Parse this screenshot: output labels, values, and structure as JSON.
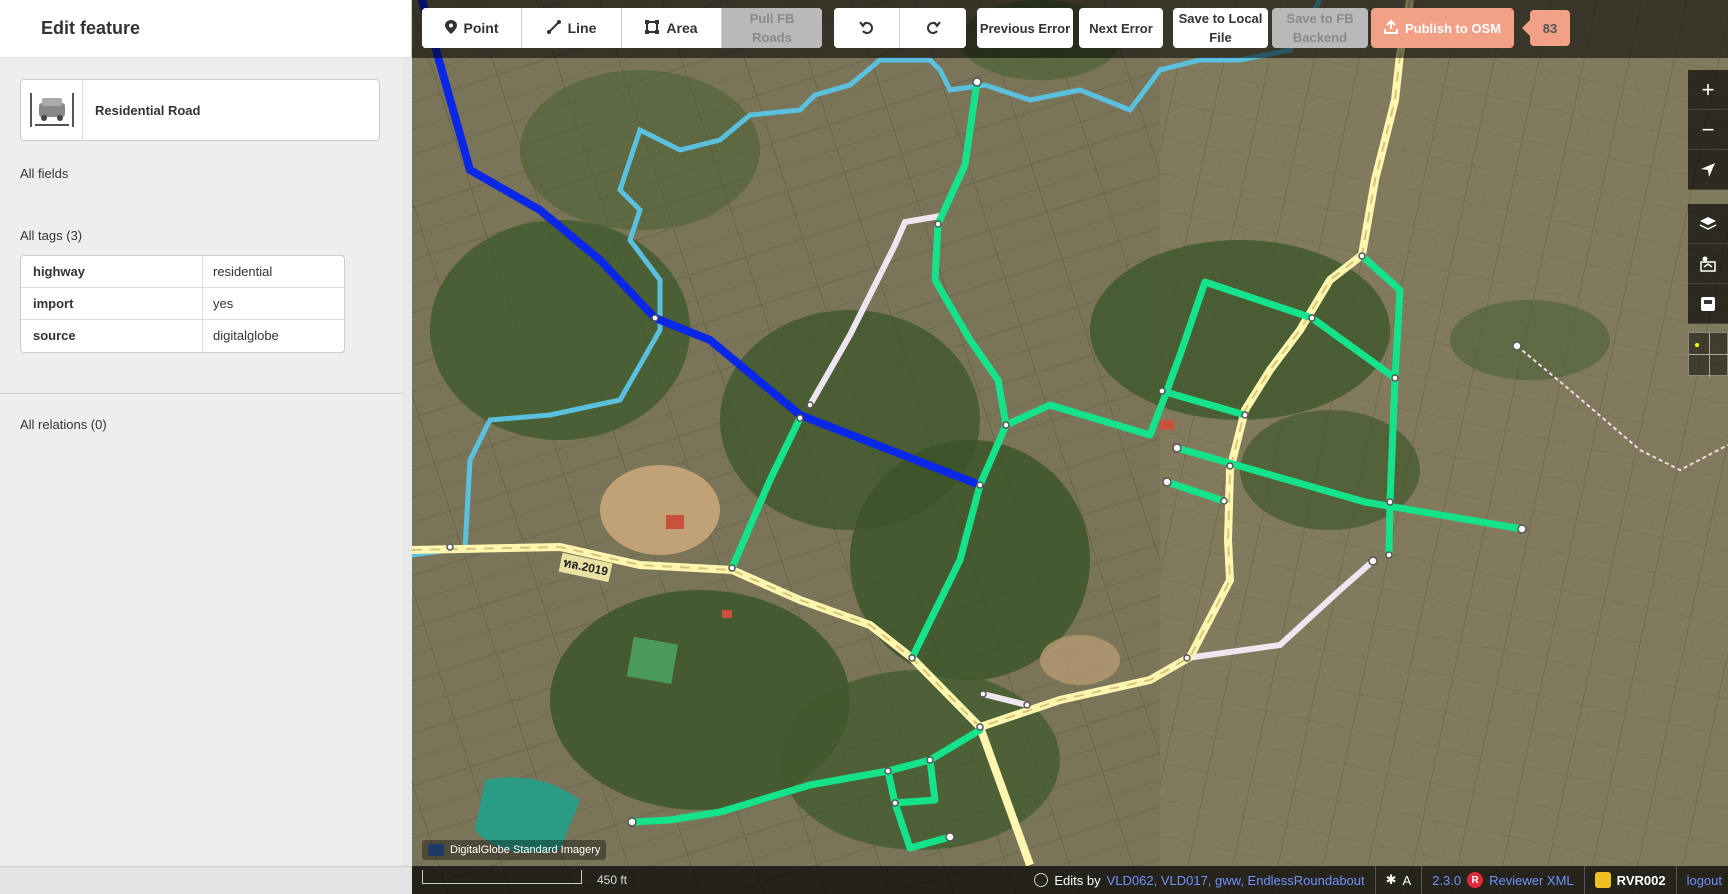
{
  "sidebar": {
    "title": "Edit feature",
    "preset": {
      "name": "Residential Road",
      "icon": "car-road-icon"
    },
    "all_fields_label": "All fields",
    "all_tags_label": "All tags (3)",
    "tags": [
      {
        "key": "highway",
        "value": "residential"
      },
      {
        "key": "import",
        "value": "yes"
      },
      {
        "key": "source",
        "value": "digitalglobe"
      }
    ],
    "all_relations_label": "All relations (0)"
  },
  "toolbar": {
    "point_label": "Point",
    "line_label": "Line",
    "area_label": "Area",
    "pull_fb_roads_line1": "Pull FB",
    "pull_fb_roads_line2": "Roads",
    "undo_icon": "undo-icon",
    "redo_icon": "redo-icon",
    "previous_error_label": "Previous Error",
    "next_error_label": "Next Error",
    "save_local_line1": "Save to Local",
    "save_local_line2": "File",
    "save_fb_line1": "Save to FB",
    "save_fb_line2": "Backend",
    "publish_label": "Publish to OSM",
    "edit_count": "83"
  },
  "map": {
    "road_label": "ทล.2019",
    "imagery_attribution": "DigitalGlobe Standard Imagery",
    "scale_label": "450 ft",
    "colors": {
      "residential": "#15e38b",
      "primary": "#0a26e6",
      "secondary": "#fff6b0",
      "track": "#f0e6f0",
      "waterway": "#5bc0de"
    }
  },
  "map_controls": [
    "zoom-in-icon",
    "zoom-out-icon",
    "locate-icon",
    "layers-icon",
    "map-data-icon",
    "issues-icon"
  ],
  "footer": {
    "edits_by_label": "Edits by",
    "editors": "VLD062, VLD017, gww, EndlessRoundabout",
    "version": "2.3.0",
    "reviewer_label": "Reviewer XML",
    "user": "RVR002",
    "logout_label": "logout"
  }
}
